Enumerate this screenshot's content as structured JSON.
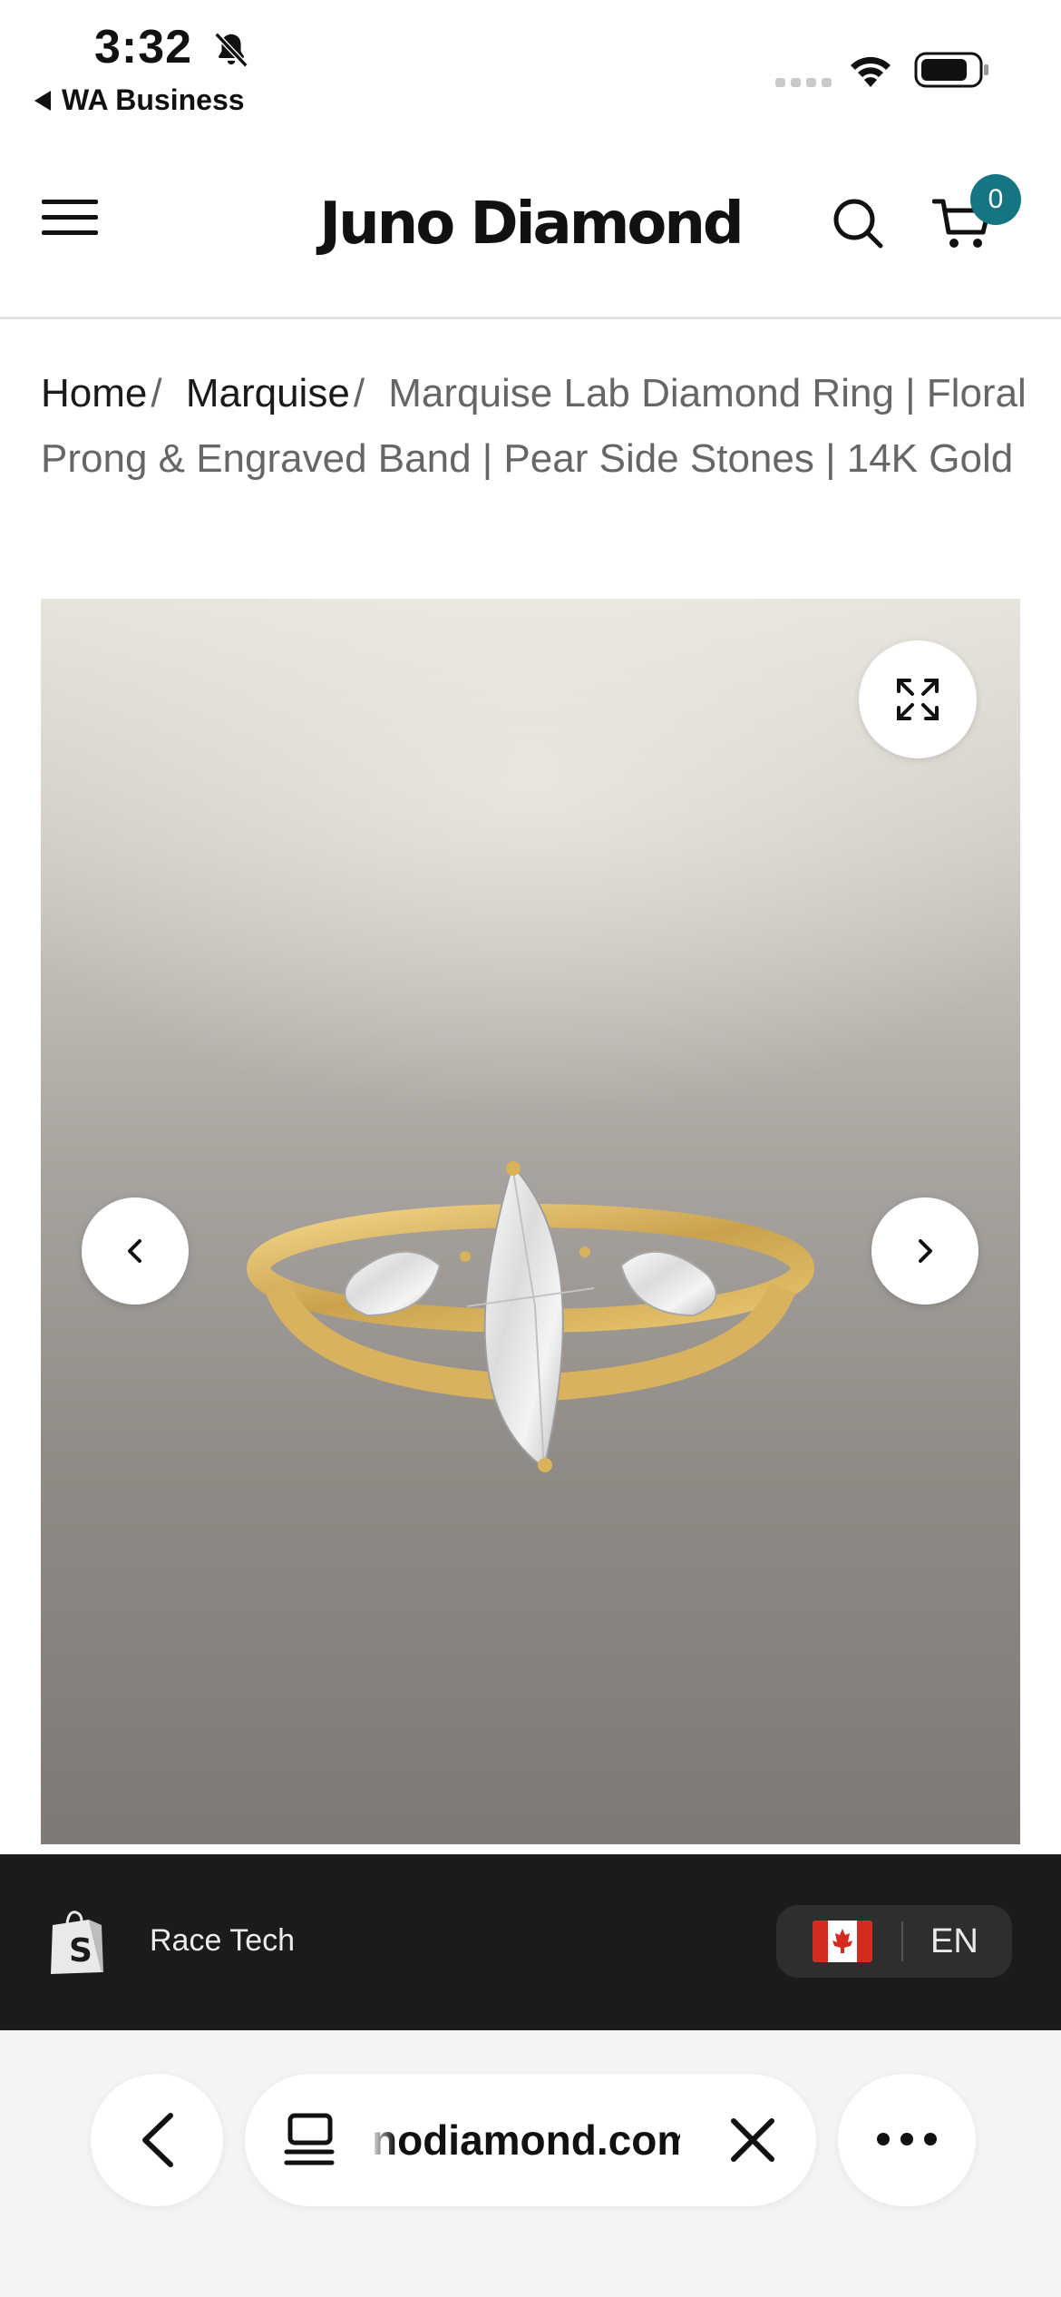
{
  "status_bar": {
    "time": "3:32",
    "back_app_label": "WA Business",
    "icons": [
      "bell-slash-icon",
      "cellular-signal-icon",
      "wifi-icon",
      "battery-icon"
    ]
  },
  "header": {
    "logo": "Juno Diamond",
    "cart_count": "0",
    "icons": [
      "hamburger-menu-icon",
      "search-icon",
      "cart-icon"
    ],
    "accent_color": "#157582"
  },
  "breadcrumb": {
    "items": [
      {
        "label": "Home"
      },
      {
        "label": "Marquise"
      }
    ],
    "separator": "/",
    "current": "Marquise Lab Diamond Ring | Floral Prong & Engraved Band | Pear Side Stones | 14K Gold"
  },
  "gallery": {
    "icons": [
      "expand-icon",
      "chevron-left-icon",
      "chevron-right-icon"
    ]
  },
  "shop_bar": {
    "shop_name": "Race Tech",
    "language": "EN",
    "icons": [
      "shopify-bag-icon",
      "canada-flag-icon"
    ],
    "background": "#1b1b1b"
  },
  "browser_bar": {
    "url": "nodiamond.com",
    "icons": [
      "back-arrow-icon",
      "tabs-icon",
      "close-icon",
      "more-dots-icon"
    ]
  }
}
